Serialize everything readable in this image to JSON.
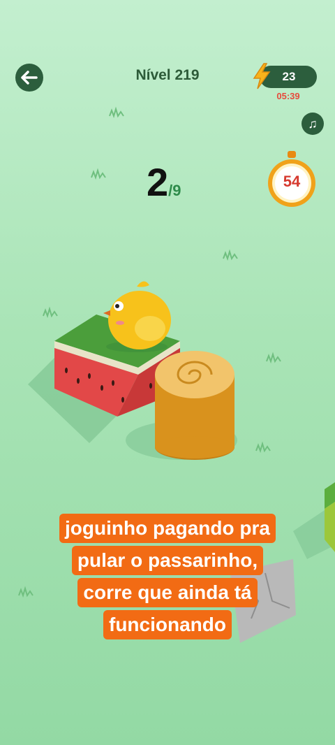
{
  "header": {
    "level_label": "Nível 219",
    "energy_count": "23",
    "timer": "05:39"
  },
  "progress": {
    "current": "2",
    "total": "/9"
  },
  "stopwatch": {
    "value": "54"
  },
  "caption": {
    "lines": [
      "joguinho pagando pra",
      "pular o passarinho,",
      "corre que ainda tá",
      "funcionando"
    ]
  },
  "colors": {
    "accent": "#2c5e3d",
    "timer_red": "#e64b3c",
    "caption_bg": "#f26b14"
  }
}
